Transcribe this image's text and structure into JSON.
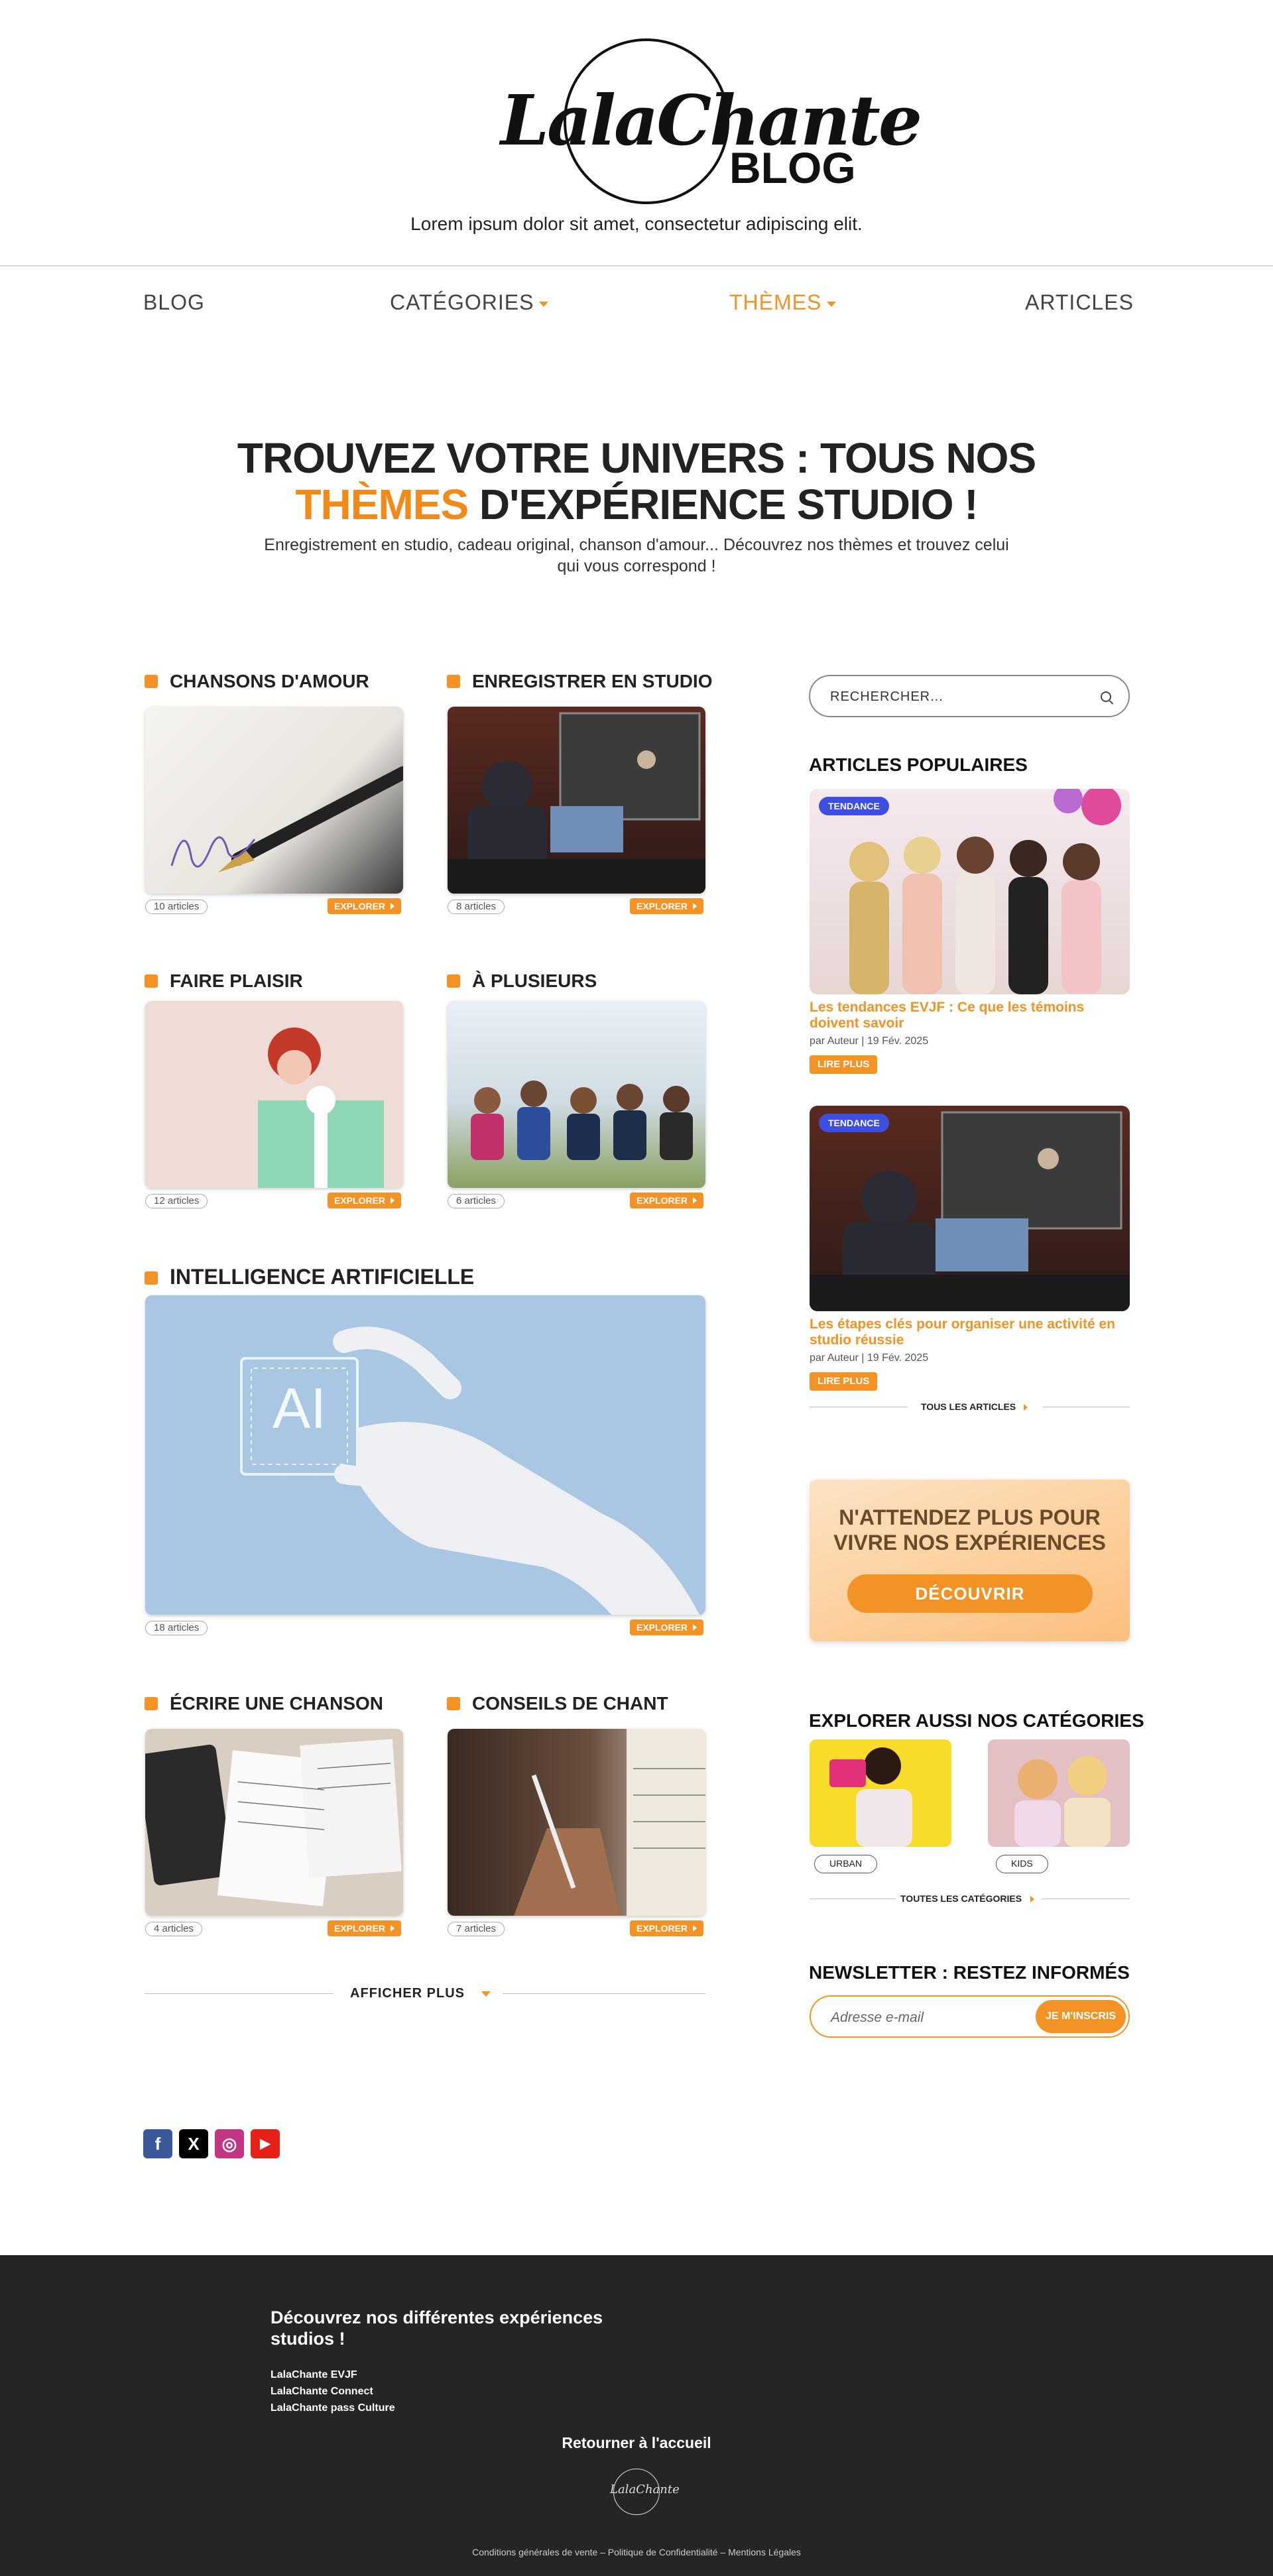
{
  "header": {
    "logo_script": "LalaChante",
    "logo_blog": "BLOG",
    "tagline": "Lorem ipsum dolor sit amet, consectetur adipiscing elit."
  },
  "nav": {
    "items": [
      {
        "label": "BLOG"
      },
      {
        "label": "CATÉGORIES"
      },
      {
        "label": "THÈMES"
      },
      {
        "label": "ARTICLES"
      }
    ]
  },
  "hero": {
    "title_line1": "TROUVEZ VOTRE UNIVERS : TOUS NOS",
    "title_highlight": "THÈMES",
    "title_line2_rest": " D'EXPÉRIENCE STUDIO !",
    "subtitle": "Enregistrement en studio, cadeau original, chanson d'amour... Découvrez nos thèmes et trouvez celui qui vous correspond !"
  },
  "themes": [
    {
      "title": "CHANSONS D'AMOUR",
      "count": "10 articles",
      "explore": "EXPLORER"
    },
    {
      "title": "ENREGISTRER EN STUDIO",
      "count": "8 articles",
      "explore": "EXPLORER"
    },
    {
      "title": "FAIRE PLAISIR",
      "count": "12 articles",
      "explore": "EXPLORER"
    },
    {
      "title": "À PLUSIEURS",
      "count": "6 articles",
      "explore": "EXPLORER"
    },
    {
      "title": "INTELLIGENCE ARTIFICIELLE",
      "count": "18 articles",
      "explore": "EXPLORER",
      "image_text": "AI"
    },
    {
      "title": "ÉCRIRE UNE CHANSON",
      "count": "4 articles",
      "explore": "EXPLORER"
    },
    {
      "title": "CONSEILS DE CHANT",
      "count": "7 articles",
      "explore": "EXPLORER"
    }
  ],
  "show_more": "AFFICHER PLUS",
  "socials": [
    {
      "icon": "facebook-icon",
      "glyph": "f",
      "color": "#3b5998"
    },
    {
      "icon": "x-icon",
      "glyph": "X",
      "color": "#000000"
    },
    {
      "icon": "instagram-icon",
      "glyph": "◎",
      "color": "#c13584"
    },
    {
      "icon": "youtube-icon",
      "glyph": "▶",
      "color": "#e62117"
    }
  ],
  "sidebar": {
    "search_placeholder": "RECHERCHER...",
    "popular_heading": "ARTICLES POPULAIRES",
    "popular": [
      {
        "badge": "TENDANCE",
        "title": "Les tendances EVJF : Ce que les témoins doivent savoir",
        "meta": "par Auteur | 19 Fév. 2025",
        "read_more": "LIRE PLUS"
      },
      {
        "badge": "TENDANCE",
        "title": "Les étapes clés pour organiser une activité en studio réussie",
        "meta": "par Auteur | 19 Fév. 2025",
        "read_more": "LIRE PLUS"
      }
    ],
    "all_articles": "TOUS LES ARTICLES",
    "cta_title": "N'ATTENDEZ PLUS POUR VIVRE NOS EXPÉRIENCES",
    "cta_button": "DÉCOUVRIR",
    "categories_heading": "EXPLORER AUSSI NOS CATÉGORIES",
    "categories": [
      {
        "label": "URBAN"
      },
      {
        "label": "KIDS"
      }
    ],
    "all_categories": "TOUTES LES CATÉGORIES",
    "newsletter_heading": "NEWSLETTER : RESTEZ INFORMÉS",
    "newsletter_placeholder": "Adresse e-mail",
    "newsletter_button": "JE M'INSCRIS"
  },
  "footer": {
    "title": "Découvrez nos différentes expériences studios !",
    "links": [
      "LalaChante EVJF",
      "LalaChante Connect",
      "LalaChante pass Culture"
    ],
    "back_home": "Retourner à l'accueil",
    "logo_text": "LalaChante",
    "legal": "Conditions générales de vente – Politique de Confidentialité – Mentions Légales"
  },
  "colors": {
    "accent": "#f39325",
    "badge": "#3d4ee0",
    "footer_bg": "#252525"
  }
}
